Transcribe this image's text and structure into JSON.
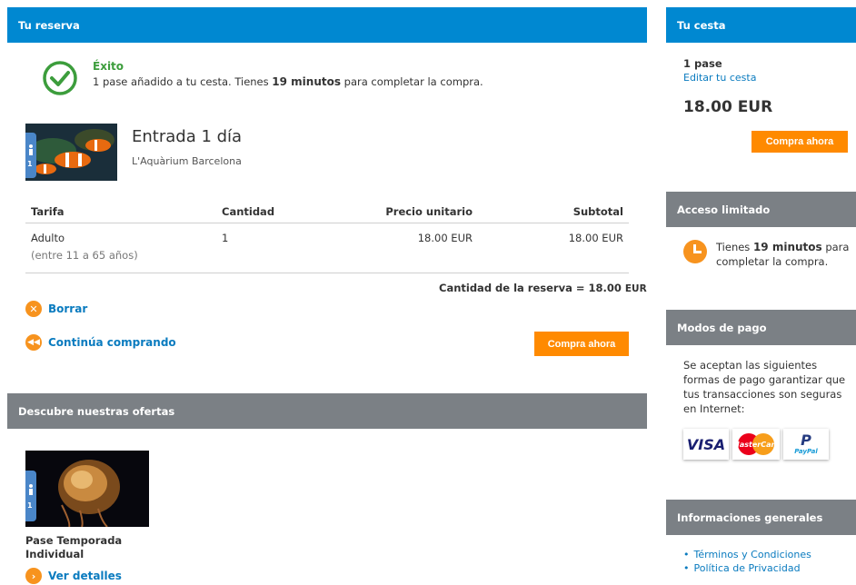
{
  "reservation": {
    "header": "Tu reserva",
    "success_title": "Éxito",
    "success_msg_before": "1 pase añadido a tu cesta. Tienes",
    "success_minutes": "19 minutos",
    "success_msg_after": "para completar la compra.",
    "product_title": "Entrada 1 día",
    "product_place": "L'Aquàrium Barcelona",
    "product_badge": "1",
    "table": {
      "headers": [
        "Tarifa",
        "Cantidad",
        "Precio unitario",
        "Subtotal"
      ],
      "rows": [
        {
          "tarifa": "Adulto",
          "note": "(entre 11 a 65 años)",
          "cantidad": "1",
          "precio": "18.00 EUR",
          "subtotal": "18.00 EUR"
        }
      ]
    },
    "total_label": "Cantidad de la reserva = 18.00",
    "total_currency": "EUR",
    "delete_label": "Borrar",
    "continue_label": "Continúa comprando",
    "buy_label": "Compra ahora"
  },
  "offers": {
    "header": "Descubre nuestras ofertas",
    "item_title": "Pase Temporada Individual",
    "item_badge": "1",
    "details_label": "Ver detalles"
  },
  "cart": {
    "header": "Tu cesta",
    "count": "1 pase",
    "edit_label": "Editar tu cesta",
    "total": "18.00 EUR",
    "buy_label": "Compra ahora"
  },
  "limited": {
    "header": "Acceso limitado",
    "text_before": "Tienes",
    "minutes": "19 minutos",
    "text_after": "para completar la compra."
  },
  "payment": {
    "header": "Modos de pago",
    "text": "Se aceptan las siguientes formas de pago garantizar que tus transacciones son seguras en Internet:",
    "visa": "VISA",
    "mastercard": "MasterCard",
    "paypal_p": "P",
    "paypal": "PayPal"
  },
  "info": {
    "header": "Informaciones generales",
    "links": [
      "Términos y Condiciones",
      "Política de Privacidad"
    ]
  },
  "icons": {
    "success": "check-circle-icon",
    "delete": "close-circle-icon",
    "continue": "rewind-circle-icon",
    "details": "chevron-right-circle-icon",
    "clock": "clock-icon",
    "person": "person-icon"
  },
  "colors": {
    "blue_header": "#0088d1",
    "gray_header": "#7b8085",
    "accent_orange": "#ff8a00",
    "success_green": "#3c9d3c",
    "link_blue": "#0a7bbf"
  }
}
